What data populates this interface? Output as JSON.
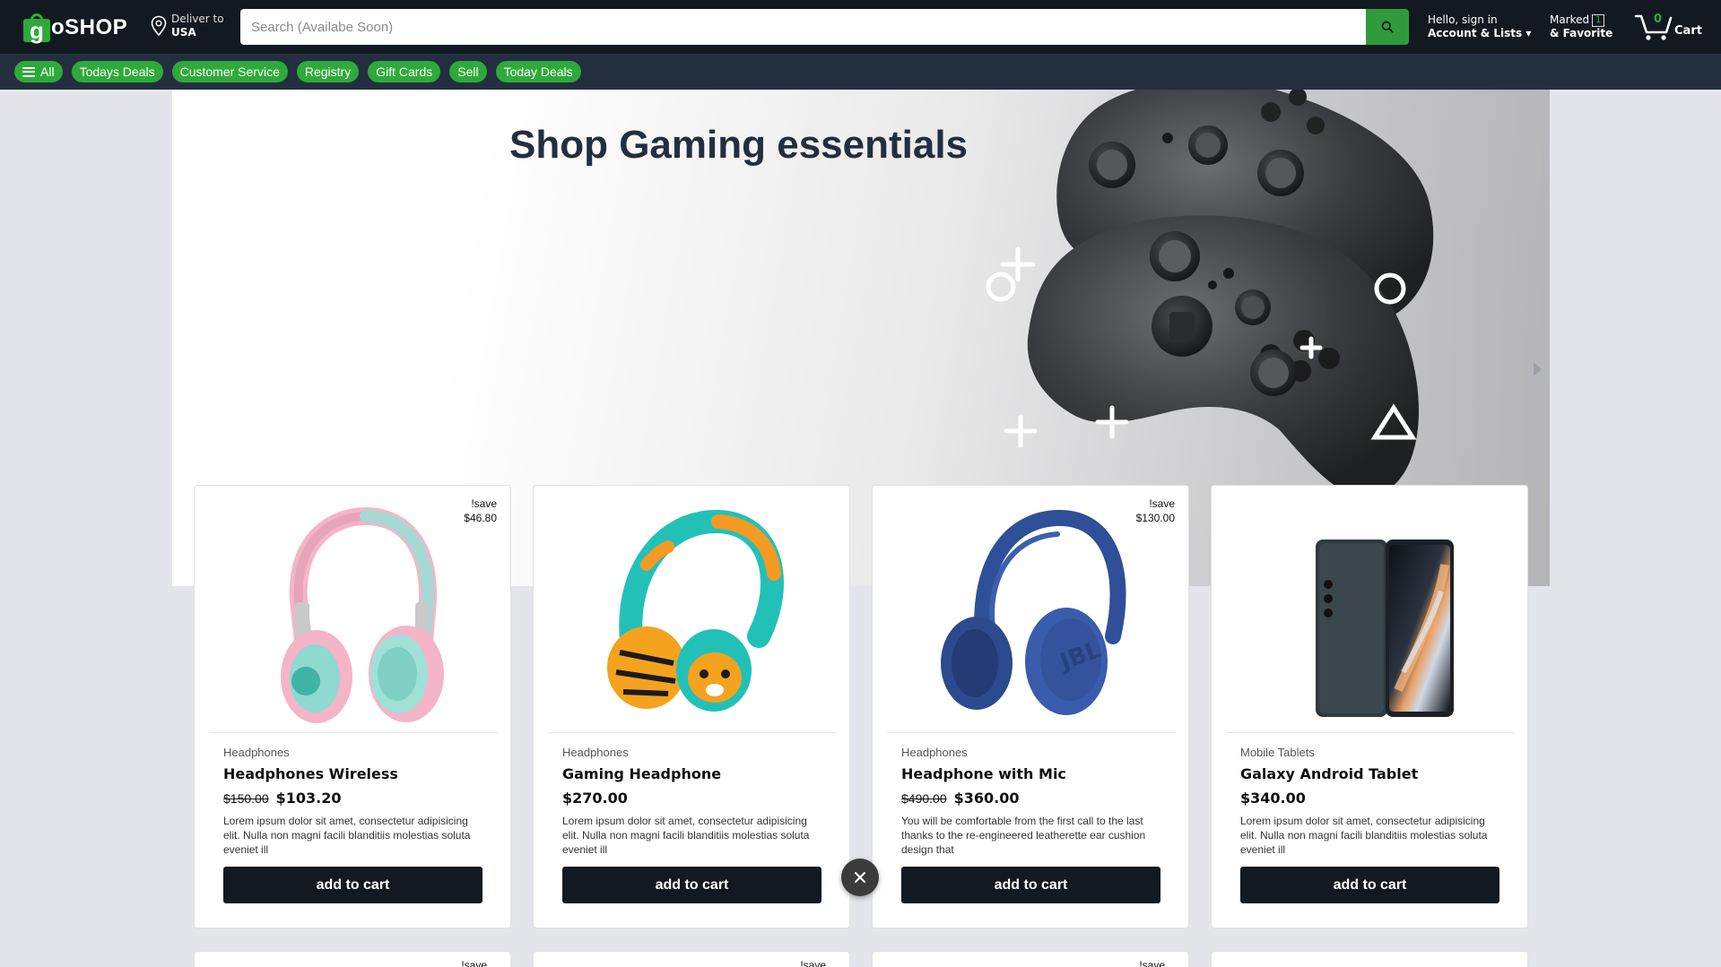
{
  "brand": {
    "logo_g": "g",
    "logo_text": "oSHOP",
    "accent": "#2eaa3a",
    "header_bg": "#131921",
    "subnav_bg": "#232f3e"
  },
  "deliver": {
    "line1": "Deliver to",
    "line2": "USA",
    "icon": "location-pin-icon"
  },
  "search": {
    "placeholder": "Search (Availabe Soon)",
    "value": "",
    "icon": "search-icon"
  },
  "account": {
    "line1": "Hello, sign in",
    "line2": "Account & Lists ▾"
  },
  "marked": {
    "line1": "Marked",
    "count": "1",
    "line2": "& Favorite"
  },
  "cart": {
    "count": "0",
    "label": "Cart",
    "icon": "cart-icon"
  },
  "nav": {
    "all_label": "All",
    "items": [
      "Todays Deals",
      "Customer Service",
      "Registry",
      "Gift Cards",
      "Sell",
      "Today Deals"
    ]
  },
  "hero": {
    "title": "Shop Gaming essentials"
  },
  "products": [
    {
      "save_label": "!save",
      "save_amount": "$46.80",
      "category": "Headphones",
      "name": "Headphones Wireless",
      "old_price": "$150.00",
      "price": "$103.20",
      "description": "Lorem ipsum dolor sit amet, consectetur adipisicing elit. Nulla non magni facili blanditiis molestias soluta eveniet ill",
      "button": "add to cart"
    },
    {
      "save_label": "",
      "save_amount": "",
      "category": "Headphones",
      "name": "Gaming Headphone",
      "old_price": "",
      "price": "$270.00",
      "description": "Lorem ipsum dolor sit amet, consectetur adipisicing elit. Nulla non magni facili blanditiis molestias soluta eveniet ill",
      "button": "add to cart"
    },
    {
      "save_label": "!save",
      "save_amount": "$130.00",
      "category": "Headphones",
      "name": "Headphone with Mic",
      "old_price": "$490.00",
      "price": "$360.00",
      "description": "You will be comfortable from the first call to the last thanks to the re-engineered leatherette ear cushion design that",
      "button": "add to cart"
    },
    {
      "save_label": "",
      "save_amount": "",
      "category": "Mobile Tablets",
      "name": "Galaxy Android Tablet",
      "old_price": "",
      "price": "$340.00",
      "description": "Lorem ipsum dolor sit amet, consectetur adipisicing elit. Nulla non magni facili blanditiis molestias soluta eveniet ill",
      "button": "add to cart"
    }
  ],
  "row2_save": [
    "!save",
    "!save",
    "!save"
  ]
}
